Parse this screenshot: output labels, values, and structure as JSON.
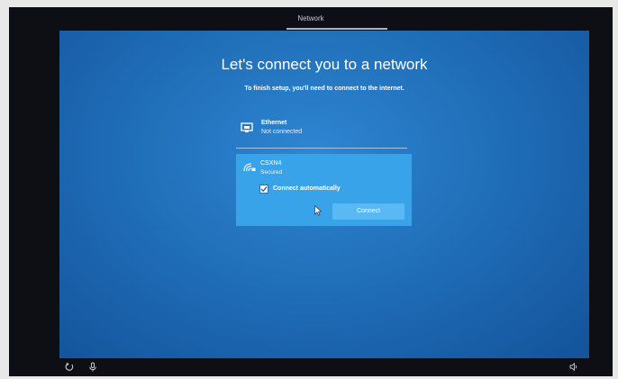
{
  "topbar": {
    "title": "Network"
  },
  "page": {
    "title": "Let's connect you to a network",
    "subtitle": "To finish setup, you'll need to connect to the internet."
  },
  "networks": {
    "ethernet": {
      "name": "Ethernet",
      "status": "Not connected",
      "icon": "ethernet-icon"
    },
    "wifi": {
      "name": "CSXN4",
      "status": "Secured",
      "icon": "wifi-secured-icon",
      "connect_automatically_label": "Connect automatically",
      "connect_automatically_checked": true,
      "connect_button_label": "Connect"
    }
  },
  "bottombar": {
    "left_icons": [
      "ease-of-access-icon",
      "microphone-icon"
    ],
    "right_icons": [
      "volume-icon"
    ]
  },
  "colors": {
    "background": "#206fb9",
    "selected_card": "#39a3ea",
    "button": "#5ab9f3"
  }
}
